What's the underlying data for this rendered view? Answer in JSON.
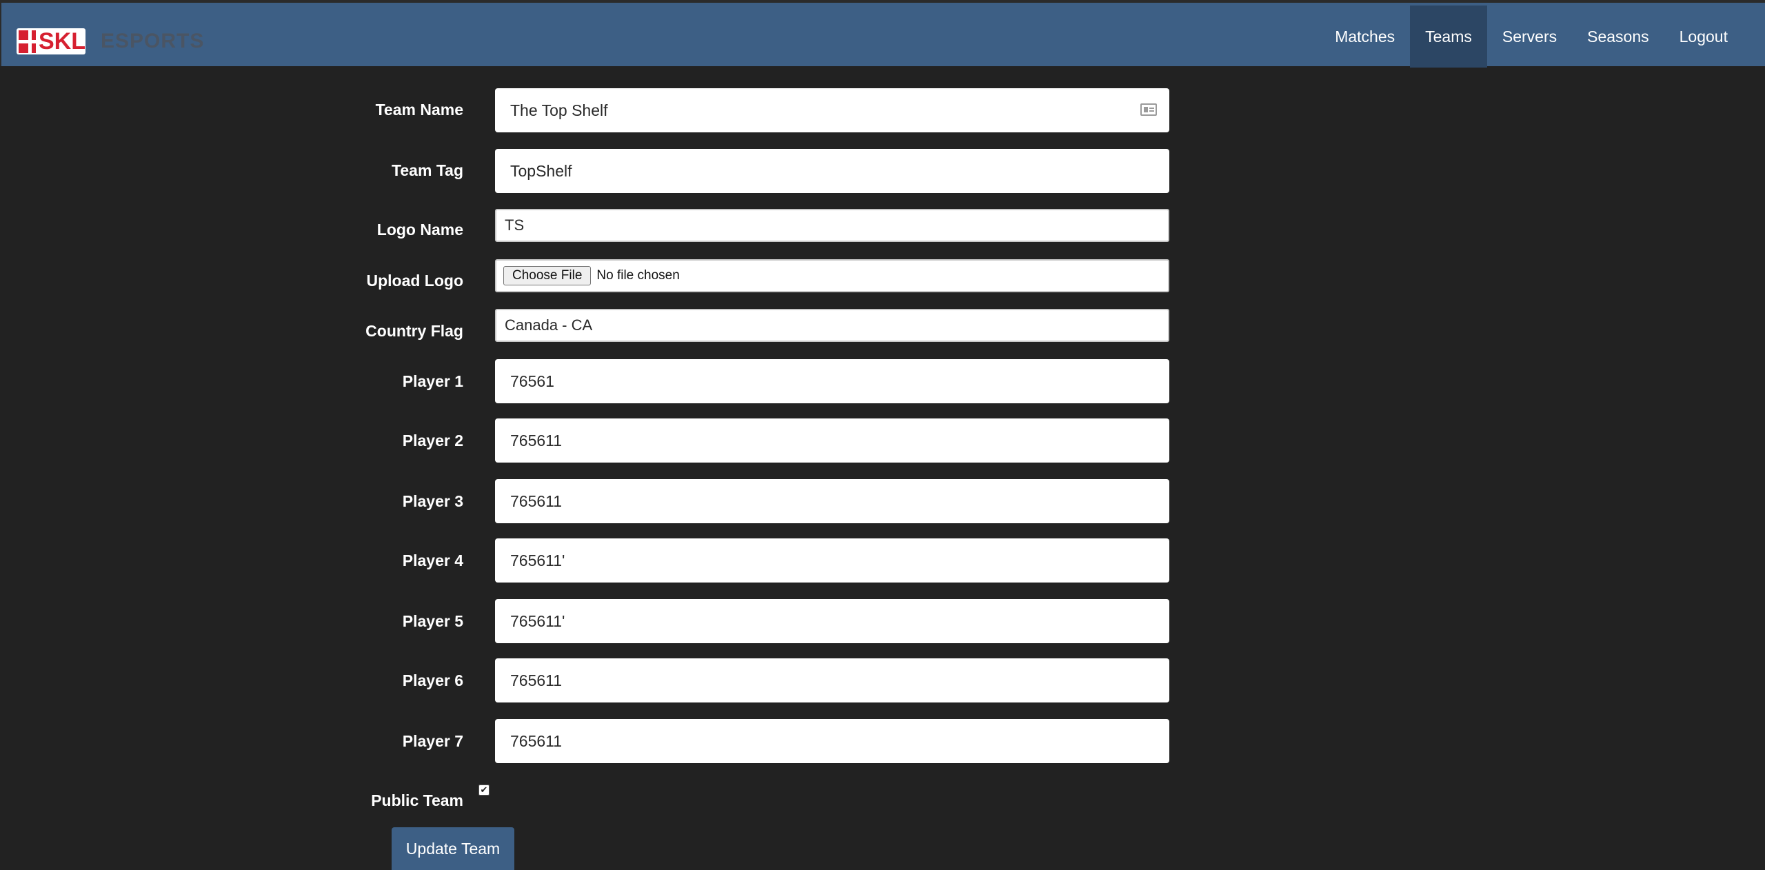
{
  "brand": {
    "logo_text": "SKL",
    "subtitle": "ESPORTS"
  },
  "nav": {
    "items": [
      {
        "label": "Matches",
        "active": false
      },
      {
        "label": "Teams",
        "active": true
      },
      {
        "label": "Servers",
        "active": false
      },
      {
        "label": "Seasons",
        "active": false
      },
      {
        "label": "Logout",
        "active": false
      }
    ]
  },
  "form": {
    "team_name": {
      "label": "Team Name",
      "value": "The Top Shelf"
    },
    "team_tag": {
      "label": "Team Tag",
      "value": "TopShelf"
    },
    "logo_name": {
      "label": "Logo Name",
      "value": "TS"
    },
    "upload_logo": {
      "label": "Upload Logo",
      "button": "Choose File",
      "status": "No file chosen"
    },
    "country_flag": {
      "label": "Country Flag",
      "value": "Canada - CA"
    },
    "players": [
      {
        "label": "Player 1",
        "value": "76561"
      },
      {
        "label": "Player 2",
        "value": "765611"
      },
      {
        "label": "Player 3",
        "value": "765611"
      },
      {
        "label": "Player 4",
        "value": "765611'"
      },
      {
        "label": "Player 5",
        "value": "765611'"
      },
      {
        "label": "Player 6",
        "value": "765611"
      },
      {
        "label": "Player 7",
        "value": "765611"
      }
    ],
    "public_team": {
      "label": "Public Team",
      "checked": true,
      "check_glyph": "✔"
    },
    "submit_label": "Update Team"
  },
  "colors": {
    "navbar": "#3d5f85",
    "nav_active": "#2c4664",
    "background": "#222222",
    "brand_red": "#d62030"
  }
}
